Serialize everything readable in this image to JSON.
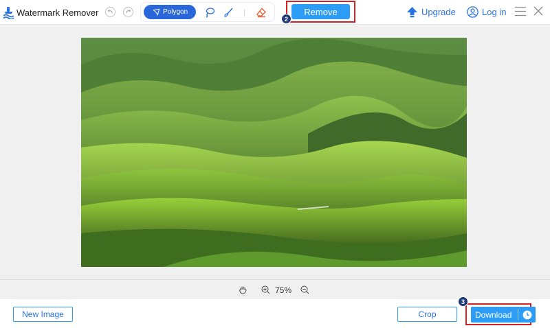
{
  "app": {
    "title": "Watermark Remover"
  },
  "toolbar": {
    "polygon_label": "Polygon",
    "remove_label": "Remove",
    "remove_step": "2"
  },
  "account": {
    "upgrade_label": "Upgrade",
    "login_label": "Log in"
  },
  "zoom": {
    "level": "75%"
  },
  "footer": {
    "new_image_label": "New Image",
    "crop_label": "Crop",
    "download_label": "Download",
    "download_step": "3"
  },
  "colors": {
    "accent": "#2d9cf6",
    "tool_active": "#2866d9",
    "link": "#2b73e0",
    "highlight_frame": "#d51f27",
    "step_badge": "#1f3b79"
  },
  "icons": {
    "logo": "watermark-logo-icon",
    "undo": "undo-icon",
    "redo": "redo-icon",
    "polygon": "polygon-icon",
    "lasso": "lasso-icon",
    "brush": "brush-icon",
    "eraser": "eraser-icon",
    "upgrade": "upgrade-arrow-icon",
    "login": "user-icon",
    "menu": "menu-icon",
    "close": "close-icon",
    "hand": "hand-icon",
    "zoom_in": "zoom-in-icon",
    "zoom_out": "zoom-out-icon",
    "history": "clock-icon"
  }
}
